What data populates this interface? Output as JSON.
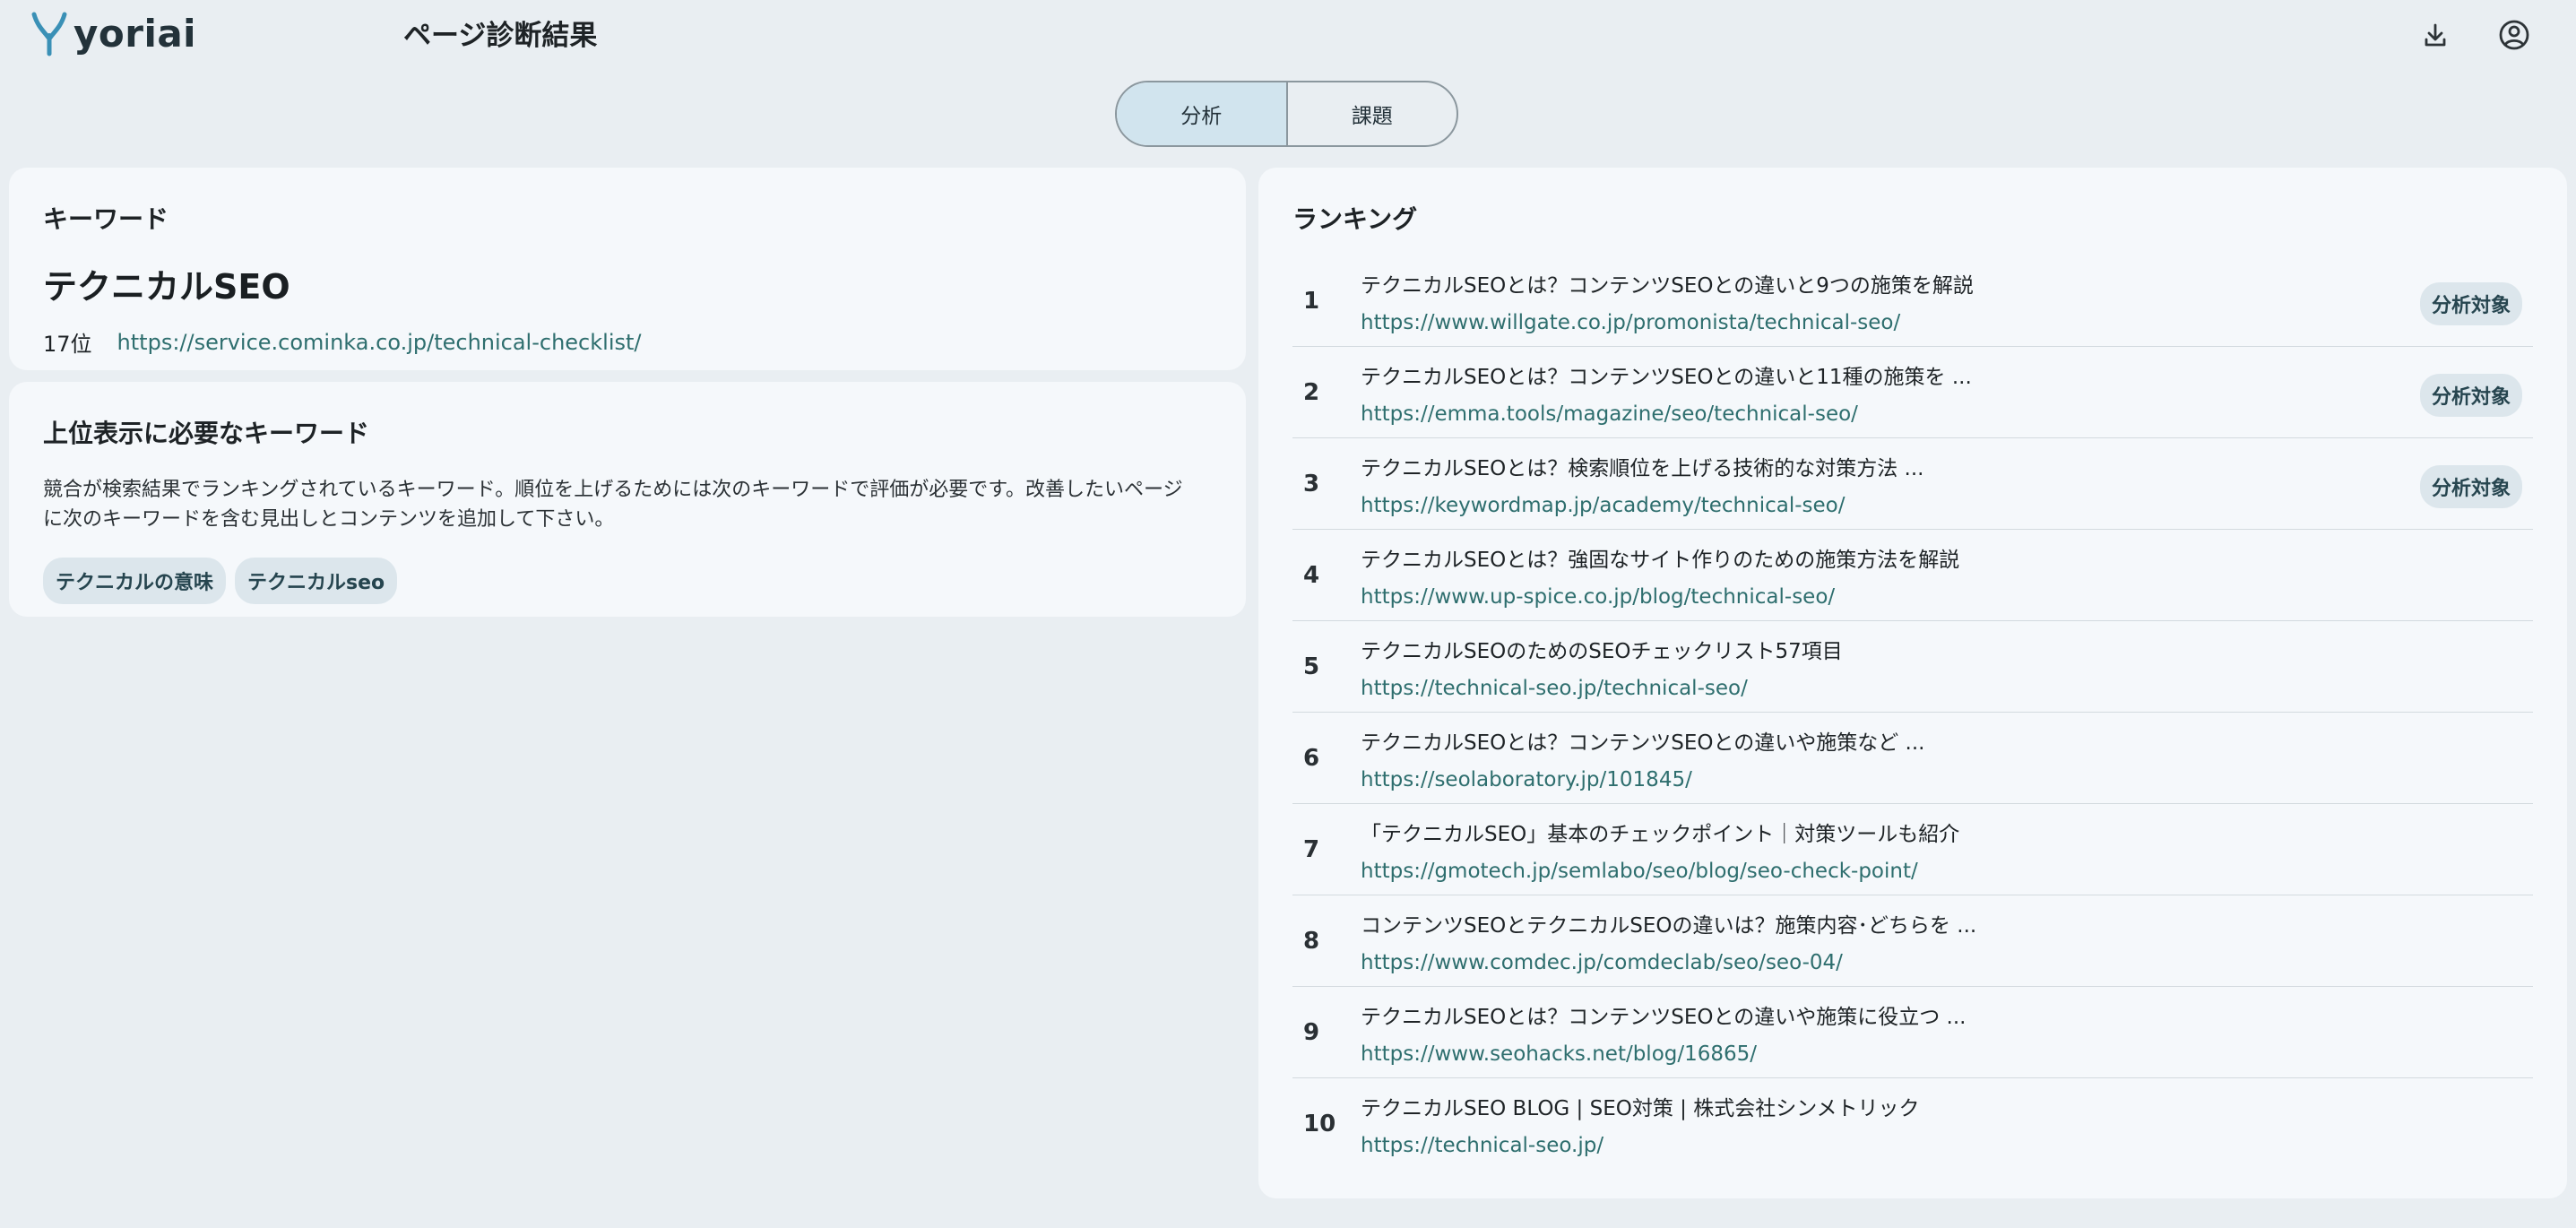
{
  "header": {
    "logo_text": "yoriai",
    "page_title": "ページ診断結果",
    "download_icon": "download-icon",
    "account_icon": "account-circle-icon"
  },
  "tabs": [
    {
      "label": "分析",
      "active": true
    },
    {
      "label": "課題",
      "active": false
    }
  ],
  "keyword_card": {
    "heading": "キーワード",
    "keyword": "テクニカルSEO",
    "position": "17位",
    "url": "https://service.cominka.co.jp/technical-checklist/"
  },
  "needed_card": {
    "heading": "上位表示に必要なキーワード",
    "description": "競合が検索結果でランキングされているキーワード。順位を上げるためには次のキーワードで評価が必要です。改善したいページに次のキーワードを含む見出しとコンテンツを追加して下さい。",
    "chips": [
      "テクニカルの意味",
      "テクニカルseo"
    ]
  },
  "ranking_card": {
    "heading": "ランキング",
    "badge_label": "分析対象",
    "items": [
      {
        "rank": "1",
        "title": "テクニカルSEOとは？コンテンツSEOとの違いと9つの施策を解説",
        "url": "https://www.willgate.co.jp/promonista/technical-seo/",
        "badge": "分析対象"
      },
      {
        "rank": "2",
        "title": "テクニカルSEOとは？コンテンツSEOとの違いと11種の施策を ...",
        "url": "https://emma.tools/magazine/seo/technical-seo/",
        "badge": "分析対象"
      },
      {
        "rank": "3",
        "title": "テクニカルSEOとは？検索順位を上げる技術的な対策方法 ...",
        "url": "https://keywordmap.jp/academy/technical-seo/",
        "badge": "分析対象"
      },
      {
        "rank": "4",
        "title": "テクニカルSEOとは？強固なサイト作りのための施策方法を解説",
        "url": "https://www.up-spice.co.jp/blog/technical-seo/",
        "badge": ""
      },
      {
        "rank": "5",
        "title": "テクニカルSEOのためのSEOチェックリスト57項目",
        "url": "https://technical-seo.jp/technical-seo/",
        "badge": ""
      },
      {
        "rank": "6",
        "title": "テクニカルSEOとは？コンテンツSEOとの違いや施策など ...",
        "url": "https://seolaboratory.jp/101845/",
        "badge": ""
      },
      {
        "rank": "7",
        "title": "「テクニカルSEO」基本のチェックポイント｜対策ツールも紹介",
        "url": "https://gmotech.jp/semlabo/seo/blog/seo-check-point/",
        "badge": ""
      },
      {
        "rank": "8",
        "title": "コンテンツSEOとテクニカルSEOの違いは？施策内容･どちらを ...",
        "url": "https://www.comdec.jp/comdeclab/seo/seo-04/",
        "badge": ""
      },
      {
        "rank": "9",
        "title": "テクニカルSEOとは？コンテンツSEOとの違いや施策に役立つ ...",
        "url": "https://www.seohacks.net/blog/16865/",
        "badge": ""
      },
      {
        "rank": "10",
        "title": "テクニカルSEO BLOG | SEO対策 | 株式会社シンメトリック",
        "url": "https://technical-seo.jp/",
        "badge": ""
      }
    ]
  },
  "colors": {
    "background": "#e9eef2",
    "card": "#f5f8fb",
    "link": "#2e6e6e",
    "logo_mark": "#3a90b6",
    "active_tab": "#d1e4ee",
    "chip": "#dce6ec"
  }
}
